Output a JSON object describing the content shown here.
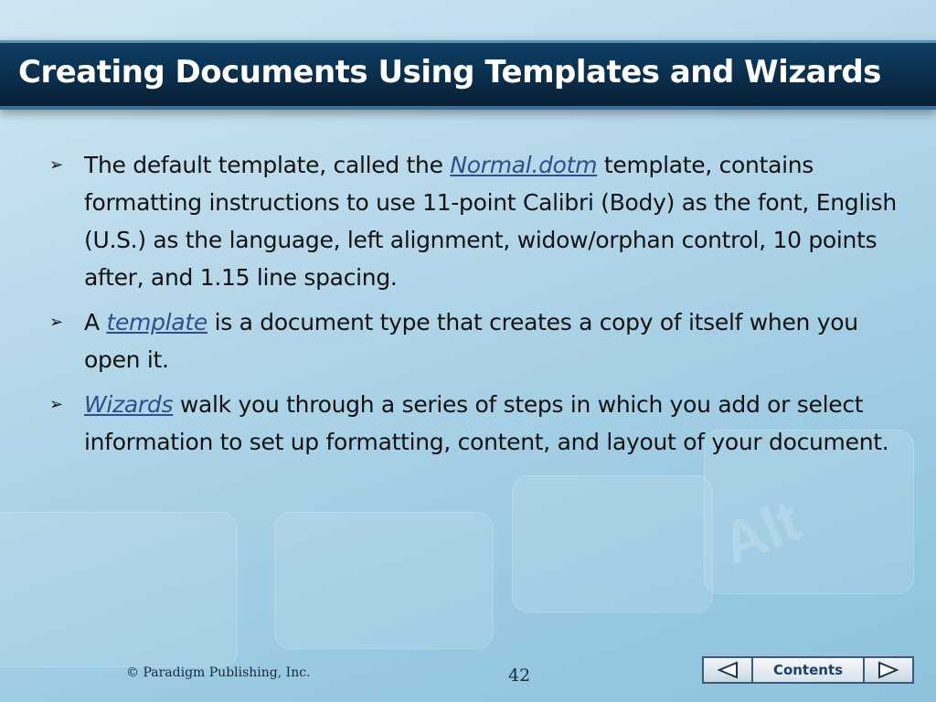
{
  "title": "Creating Documents Using Templates and Wizards",
  "bullets": [
    {
      "pre": "The default template, called the ",
      "term": "Normal.dotm",
      "post": " template, contains formatting instructions to use 11-point Calibri (Body) as the font, English (U.S.) as the language, left alignment, widow/orphan control, 10 points after, and 1.15 line spacing."
    },
    {
      "pre": "A ",
      "term": "template",
      "post": " is a document type that creates a copy of itself when you open it."
    },
    {
      "pre": "",
      "term": "Wizards",
      "post": " walk you through a series of steps in which you add or select information to set up formatting, content, and layout of your document."
    }
  ],
  "footer": {
    "copyright": "© Paradigm Publishing, Inc.",
    "page_number": "42"
  },
  "nav": {
    "contents_label": "Contents",
    "prev_icon": "triangle-left-icon",
    "next_icon": "triangle-right-icon"
  },
  "colors": {
    "title_bar": "#0a2e4b",
    "term_link": "#2e4f8c",
    "background": "#a9d2e7"
  }
}
